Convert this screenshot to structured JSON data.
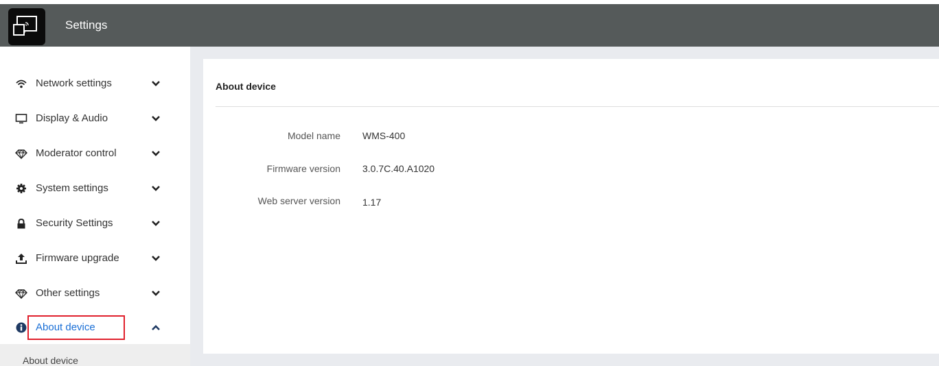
{
  "header": {
    "title": "Settings",
    "logo_icon": "cast-screen-icon"
  },
  "sidebar": {
    "items": [
      {
        "label": "Network settings",
        "icon": "wifi-icon",
        "expanded": false
      },
      {
        "label": "Display & Audio",
        "icon": "monitor-icon",
        "expanded": false
      },
      {
        "label": "Moderator control",
        "icon": "diamond-icon",
        "expanded": false
      },
      {
        "label": "System settings",
        "icon": "gear-icon",
        "expanded": false
      },
      {
        "label": "Security Settings",
        "icon": "lock-icon",
        "expanded": false
      },
      {
        "label": "Firmware upgrade",
        "icon": "upload-icon",
        "expanded": false
      },
      {
        "label": "Other settings",
        "icon": "diamond-icon",
        "expanded": false
      },
      {
        "label": "About device",
        "icon": "info-icon",
        "expanded": true,
        "active": true
      }
    ],
    "subitems": [
      {
        "label": "About device"
      }
    ]
  },
  "main": {
    "title": "About device",
    "fields": [
      {
        "label": "Model name",
        "value": "WMS-400"
      },
      {
        "label": "Firmware version",
        "value": "3.0.7C.40.A1020"
      },
      {
        "label": "Web server version",
        "value": "1.17"
      }
    ]
  },
  "colors": {
    "header_bg": "#555a5a",
    "accent": "#1a6fd6",
    "highlight_border": "#e01f2b",
    "content_bg": "#e9ebef"
  }
}
